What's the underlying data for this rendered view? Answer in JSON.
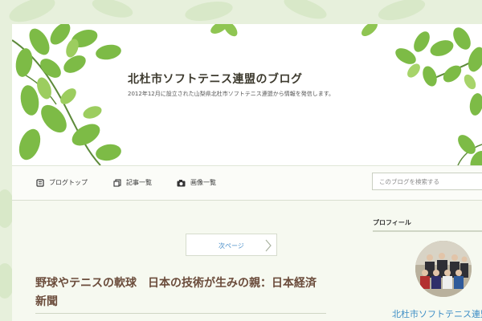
{
  "site": {
    "title": "北杜市ソフトテニス連盟のブログ",
    "description": "2012年12月に設立された山梨県北杜市ソフトテニス連盟から情報を発信します。"
  },
  "nav": {
    "items": [
      {
        "label": "ブログトップ",
        "icon": "blog-top-icon"
      },
      {
        "label": "記事一覧",
        "icon": "article-list-icon"
      },
      {
        "label": "画像一覧",
        "icon": "camera-icon"
      }
    ],
    "search_placeholder": "このブログを検索する"
  },
  "pager": {
    "next_label": "次ページ",
    "icon": "chevron-right-icon"
  },
  "article": {
    "title": "野球やテニスの軟球　日本の技術が生みの親：日本経済新聞"
  },
  "sidebar": {
    "profile_heading": "プロフィール",
    "profile_name": "北杜市ソフトテニス連盟"
  },
  "colors": {
    "background": "#e7f0dc",
    "leaf_green": "#6fae3f",
    "title_brown": "#6b4c3b",
    "link_blue": "#3f8fc6"
  }
}
